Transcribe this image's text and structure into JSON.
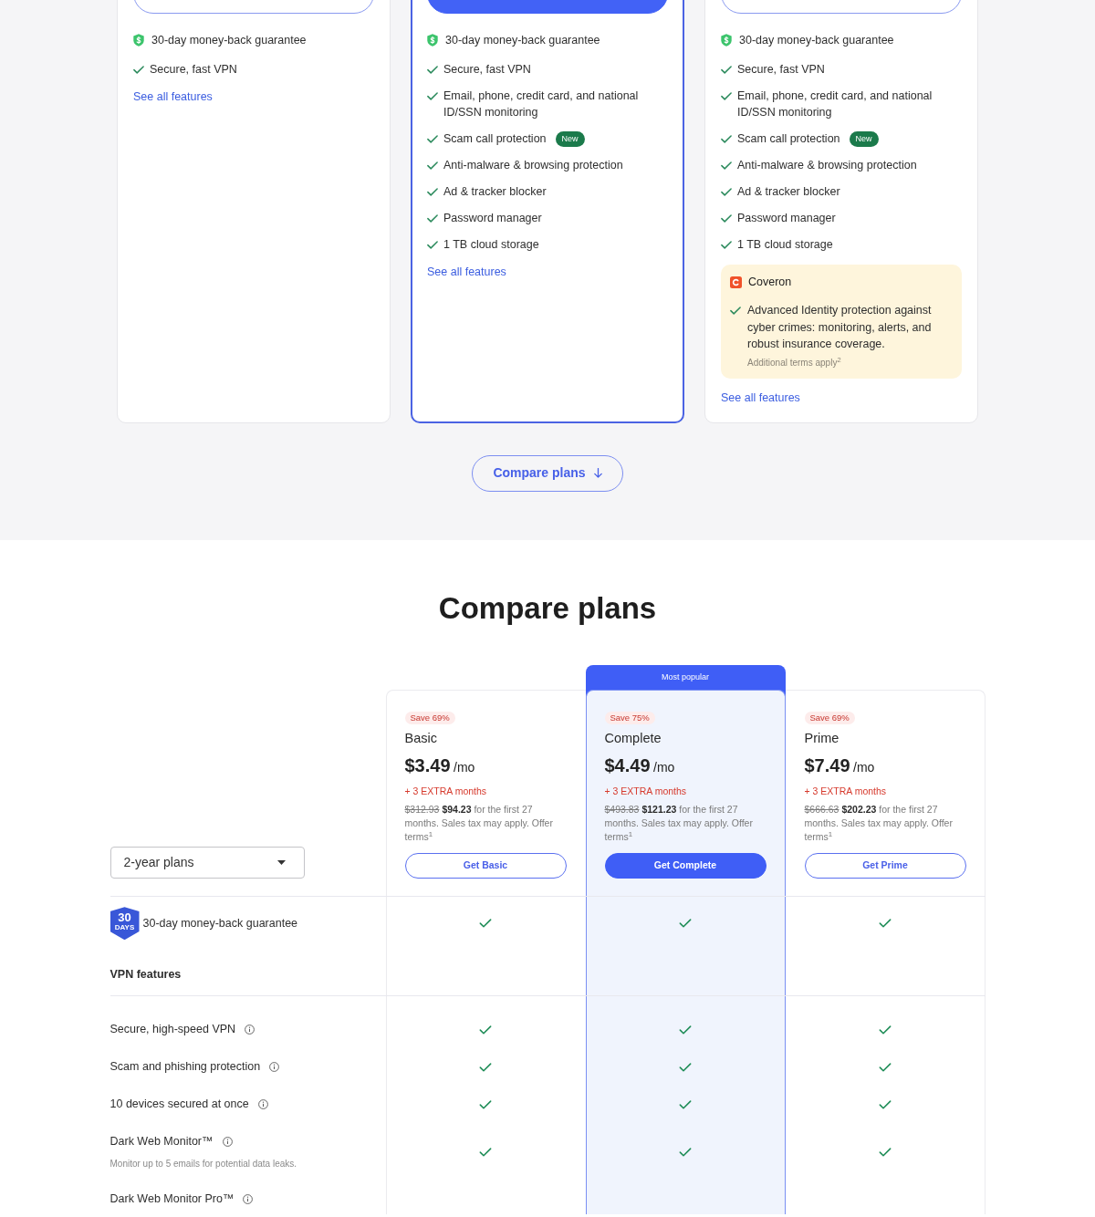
{
  "plan_cards": [
    {
      "highlighted": false,
      "guarantee": "30-day money-back guarantee",
      "features": [
        {
          "text": "Secure, fast VPN"
        }
      ],
      "link": "See all features"
    },
    {
      "highlighted": true,
      "guarantee": "30-day money-back guarantee",
      "features": [
        {
          "text": "Secure, fast VPN"
        },
        {
          "text": "Email, phone, credit card, and national ID/SSN monitoring"
        },
        {
          "text": "Scam call protection",
          "badge": "New"
        },
        {
          "text": "Anti-malware & browsing protection"
        },
        {
          "text": "Ad & tracker blocker"
        },
        {
          "text": "Password manager"
        },
        {
          "text": "1 TB cloud storage"
        }
      ],
      "link": "See all features"
    },
    {
      "highlighted": false,
      "guarantee": "30-day money-back guarantee",
      "features": [
        {
          "text": "Secure, fast VPN"
        },
        {
          "text": "Email, phone, credit card, and national ID/SSN monitoring"
        },
        {
          "text": "Scam call protection",
          "badge": "New"
        },
        {
          "text": "Anti-malware & browsing protection"
        },
        {
          "text": "Ad & tracker blocker"
        },
        {
          "text": "Password manager"
        },
        {
          "text": "1 TB cloud storage"
        }
      ],
      "addon": {
        "name": "Coveron",
        "feature": "Advanced Identity protection against cyber crimes: monitoring, alerts, and robust insurance coverage.",
        "note": "Additional terms apply$^{2}$"
      },
      "link": "See all features"
    }
  ],
  "compare_button": {
    "label": "Compare plans"
  },
  "compare": {
    "title": "Compare plans",
    "period_select": {
      "value": "2-year plans"
    },
    "plans": [
      {
        "highlighted": false,
        "save": "Save 69%",
        "name": "Basic",
        "price": "$3.49",
        "unit": "/mo",
        "extra": "+ 3 EXTRA months",
        "old_price": "$312.93",
        "total": "$94.23",
        "terms": "for the first 27 months. Sales tax may apply. Offer terms$^{1}$",
        "button": "Get Basic"
      },
      {
        "highlighted": true,
        "ribbon": "Most popular",
        "save": "Save 75%",
        "name": "Complete",
        "price": "$4.49",
        "unit": "/mo",
        "extra": "+ 3 EXTRA months",
        "old_price": "$493.83",
        "total": "$121.23",
        "terms": "for the first 27 months. Sales tax may apply. Offer terms$^{1}$",
        "button": "Get Complete"
      },
      {
        "highlighted": false,
        "save": "Save 69%",
        "name": "Prime",
        "price": "$7.49",
        "unit": "/mo",
        "extra": "+ 3 EXTRA months",
        "old_price": "$666.63",
        "total": "$202.23",
        "terms": "for the first 27 months. Sales tax may apply. Offer terms$^{1}$",
        "button": "Get Prime"
      }
    ],
    "rows": [
      {
        "kind": "guarantee",
        "badge_number": "30",
        "badge_unit": "DAYS",
        "label": "30-day money-back guarantee",
        "included": [
          true,
          true,
          true
        ]
      },
      {
        "kind": "section",
        "label": "VPN features"
      },
      {
        "kind": "feature",
        "label": "Secure, high-speed VPN",
        "info": true,
        "included": [
          true,
          true,
          true
        ]
      },
      {
        "kind": "feature",
        "label": "Scam and phishing protection",
        "info": true,
        "included": [
          true,
          true,
          true
        ]
      },
      {
        "kind": "feature",
        "label": "10 devices secured at once",
        "info": true,
        "included": [
          true,
          true,
          true
        ]
      },
      {
        "kind": "feature",
        "label": "Dark Web Monitor™",
        "info": true,
        "note": "Monitor up to 5 emails for potential data leaks.",
        "included": [
          true,
          true,
          true
        ]
      },
      {
        "kind": "feature",
        "label": "Dark Web Monitor Pro™",
        "info": true
      }
    ]
  }
}
